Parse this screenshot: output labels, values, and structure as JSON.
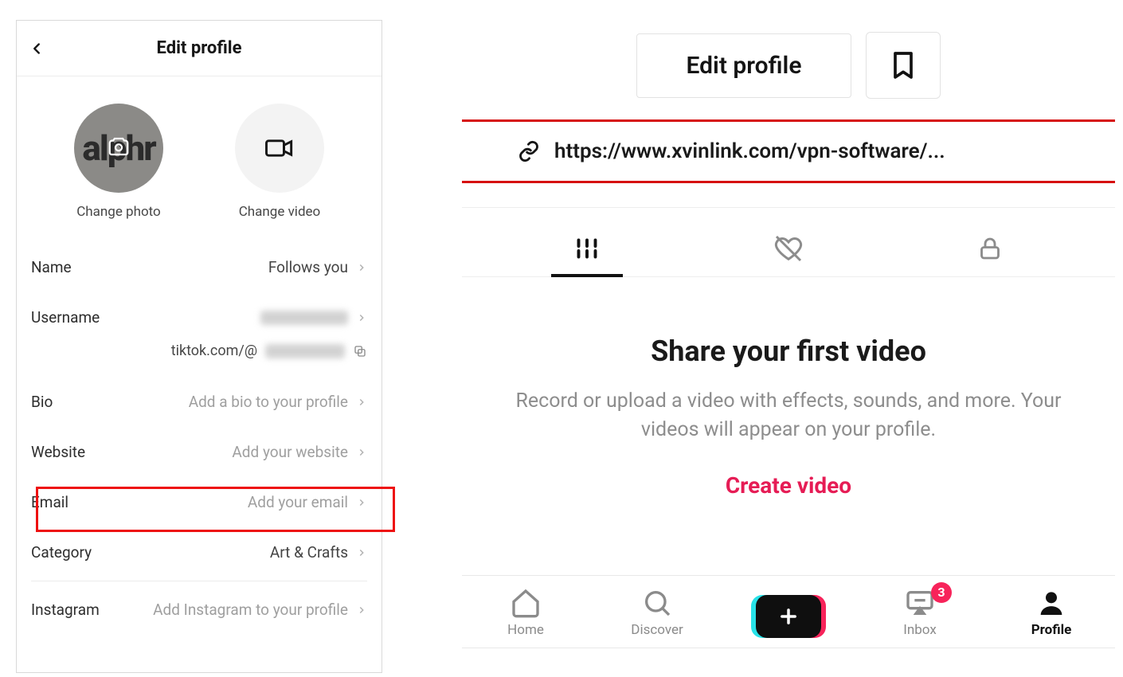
{
  "left": {
    "header_title": "Edit profile",
    "avatar_text": "alphr",
    "change_photo": "Change photo",
    "change_video": "Change video",
    "rows": {
      "name": {
        "label": "Name",
        "value": "Follows you"
      },
      "username": {
        "label": "Username"
      },
      "profile_url_prefix": "tiktok.com/@",
      "bio": {
        "label": "Bio",
        "placeholder": "Add a bio to your profile"
      },
      "website": {
        "label": "Website",
        "placeholder": "Add your website"
      },
      "email": {
        "label": "Email",
        "placeholder": "Add your email"
      },
      "category": {
        "label": "Category",
        "value": "Art & Crafts"
      },
      "instagram": {
        "label": "Instagram",
        "placeholder": "Add Instagram to your profile"
      }
    }
  },
  "right": {
    "edit_button": "Edit profile",
    "link_url": "https://www.xvinlink.com/vpn-software/...",
    "share_title": "Share your first video",
    "share_desc": "Record or upload a video with effects, sounds, and more. Your videos will appear on your profile.",
    "create_cta": "Create video",
    "nav": {
      "home": "Home",
      "discover": "Discover",
      "inbox": "Inbox",
      "inbox_badge": "3",
      "profile": "Profile"
    }
  }
}
